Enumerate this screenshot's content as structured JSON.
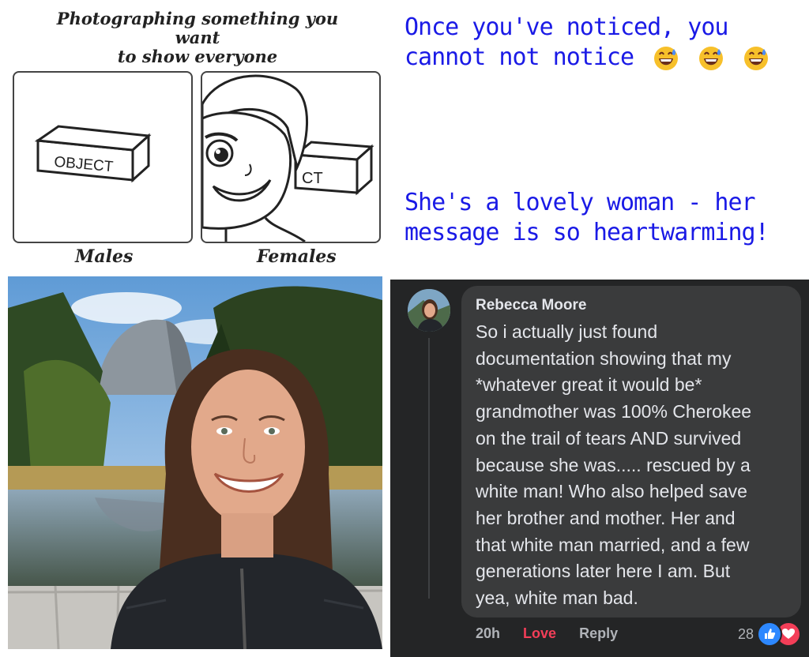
{
  "comic": {
    "title_line1": "Photographing something you want",
    "title_line2": "to show everyone",
    "left_caption": "Males",
    "right_caption": "Females",
    "left_box_label": "OBJECT",
    "right_box_label": "CT"
  },
  "captions": {
    "top": {
      "line1": "Once you've noticed, you",
      "line2": "cannot not notice"
    },
    "bottom": {
      "line1": "She's a lovely woman - her",
      "line2": "message is so heartwarming!"
    },
    "emoji_icon": "grinning-sweat-emoji"
  },
  "comment": {
    "author": "Rebecca Moore",
    "lines": [
      "So i actually just found",
      "documentation showing that my",
      "*whatever great it would be*",
      "grandmother was 100% Cherokee",
      "on the trail of tears AND survived",
      "because she was..... rescued by a",
      "white man! Who also helped save",
      "her brother and mother. Her and",
      "that white man married, and a few",
      "generations later here I am. But",
      "yea, white man bad."
    ],
    "time": "20h",
    "love_label": "Love",
    "reply_label": "Reply",
    "reaction_count": "28"
  },
  "colors": {
    "caption_blue": "#1a1ae6",
    "fb_background": "#242526",
    "fb_bubble": "#3a3b3c",
    "love_red": "#f33e58",
    "like_blue": "#2d88ff"
  }
}
